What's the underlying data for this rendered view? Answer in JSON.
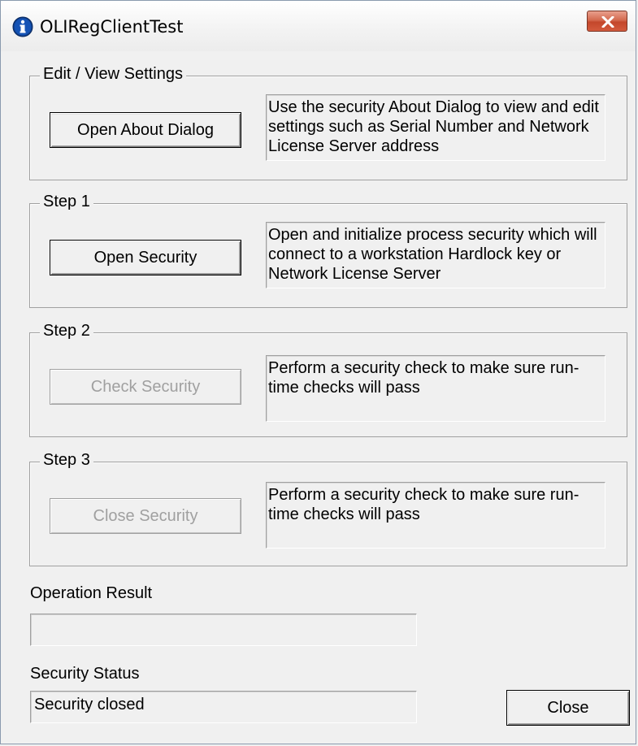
{
  "window": {
    "title": "OLIRegClientTest",
    "title_icon": "info-icon",
    "close_icon": "close-icon"
  },
  "groups": [
    {
      "legend": "Edit / View Settings",
      "button_label": "Open About Dialog",
      "button_enabled": true,
      "description": "Use the security About Dialog to view and edit settings such as Serial Number and Network License Server address"
    },
    {
      "legend": "Step 1",
      "button_label": "Open Security",
      "button_enabled": true,
      "description": "Open and initialize process security which will connect to a workstation Hardlock key or Network License Server"
    },
    {
      "legend": "Step 2",
      "button_label": "Check Security",
      "button_enabled": false,
      "description": "Perform a security check to make sure run-time checks will pass"
    },
    {
      "legend": "Step 3",
      "button_label": "Close Security",
      "button_enabled": false,
      "description": "Perform a security check to make sure run-time checks will pass"
    }
  ],
  "operation_result": {
    "label": "Operation Result",
    "value": ""
  },
  "security_status": {
    "label": "Security Status",
    "value": "Security closed"
  },
  "close_button_label": "Close",
  "colors": {
    "window_bg": "#f0f0f0",
    "close_button_red": "#c4472b",
    "disabled_text": "#a0a0a0"
  }
}
